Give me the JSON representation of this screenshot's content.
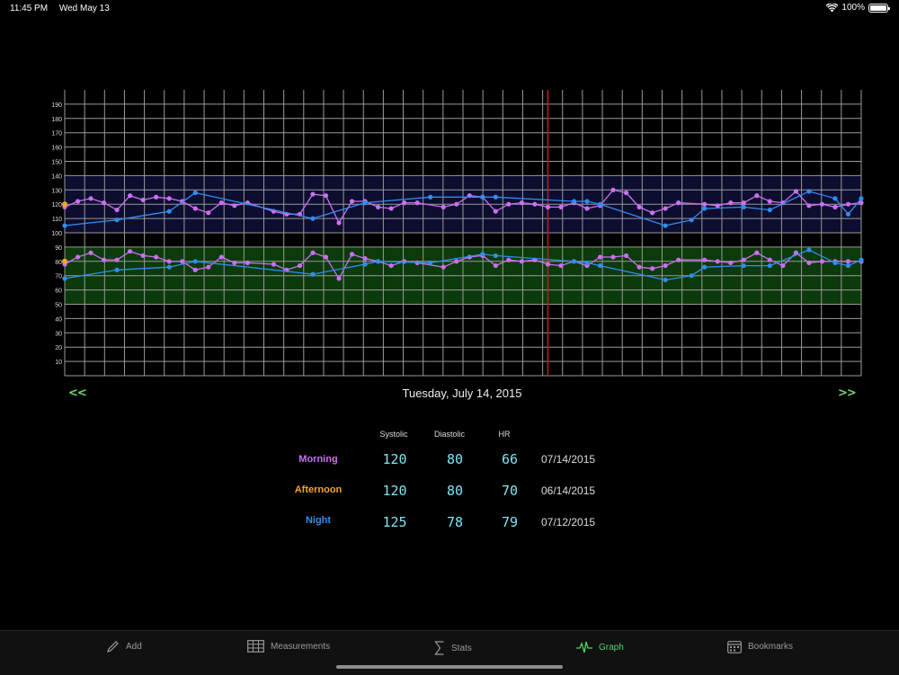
{
  "status": {
    "time": "11:45 PM",
    "date": "Wed May 13",
    "battery": "100%"
  },
  "chart_data": {
    "type": "line",
    "ylim": [
      0,
      200
    ],
    "yticks": [
      "10",
      "20",
      "30",
      "40",
      "50",
      "60",
      "70",
      "80",
      "90",
      "100",
      "110",
      "120",
      "130",
      "140",
      "150",
      "160",
      "170",
      "180",
      "190"
    ],
    "bands": [
      {
        "from": 100,
        "to": 140,
        "color": "#0d0d30"
      },
      {
        "from": 50,
        "to": 90,
        "color": "#0b3a0b"
      }
    ],
    "cursor_index": 18.5,
    "x_count": 41,
    "series": [
      {
        "line": "morning-systolic",
        "color": "#cc6ff0",
        "points": [
          [
            0,
            118
          ],
          [
            0.5,
            122
          ],
          [
            1,
            124
          ],
          [
            1.5,
            121
          ],
          [
            2,
            116
          ],
          [
            2.5,
            126
          ],
          [
            3,
            123
          ],
          [
            3.5,
            125
          ],
          [
            4,
            124
          ],
          [
            4.5,
            122
          ],
          [
            5,
            117
          ],
          [
            5.5,
            114
          ],
          [
            6,
            121
          ],
          [
            6.5,
            119
          ],
          [
            7,
            121
          ],
          [
            8,
            115
          ],
          [
            8.5,
            113
          ],
          [
            9,
            113
          ],
          [
            9.5,
            127
          ],
          [
            10,
            126
          ],
          [
            10.5,
            107
          ],
          [
            11,
            122
          ],
          [
            11.5,
            122
          ],
          [
            12,
            118
          ],
          [
            12.5,
            117
          ],
          [
            13,
            121
          ],
          [
            13.5,
            121
          ],
          [
            14.5,
            118
          ],
          [
            15,
            120
          ],
          [
            15.5,
            126
          ],
          [
            16,
            125
          ],
          [
            16.5,
            115
          ],
          [
            17,
            120
          ],
          [
            17.5,
            121
          ],
          [
            18,
            120
          ],
          [
            18.5,
            118
          ],
          [
            19,
            118
          ],
          [
            19.5,
            121
          ],
          [
            20,
            117
          ],
          [
            20.5,
            119
          ],
          [
            21,
            130
          ],
          [
            21.5,
            128
          ],
          [
            22,
            118
          ],
          [
            22.5,
            114
          ],
          [
            23,
            117
          ],
          [
            23.5,
            121
          ],
          [
            24.5,
            120
          ],
          [
            25,
            119
          ],
          [
            25.5,
            121
          ],
          [
            26,
            121
          ],
          [
            26.5,
            126
          ],
          [
            27,
            122
          ],
          [
            27.5,
            121
          ],
          [
            28,
            129
          ],
          [
            28.5,
            119
          ],
          [
            29,
            120
          ],
          [
            29.5,
            118
          ],
          [
            30,
            120
          ],
          [
            30.5,
            121
          ]
        ]
      },
      {
        "line": "morning-diastolic",
        "color": "#cc6ff0",
        "points": [
          [
            0,
            78
          ],
          [
            0.5,
            83
          ],
          [
            1,
            86
          ],
          [
            1.5,
            81
          ],
          [
            2,
            81
          ],
          [
            2.5,
            87
          ],
          [
            3,
            84
          ],
          [
            3.5,
            83
          ],
          [
            4,
            80
          ],
          [
            4.5,
            80
          ],
          [
            5,
            74
          ],
          [
            5.5,
            76
          ],
          [
            6,
            83
          ],
          [
            6.5,
            79
          ],
          [
            7,
            79
          ],
          [
            8,
            78
          ],
          [
            8.5,
            74
          ],
          [
            9,
            77
          ],
          [
            9.5,
            86
          ],
          [
            10,
            83
          ],
          [
            10.5,
            68
          ],
          [
            11,
            85
          ],
          [
            11.5,
            82
          ],
          [
            12,
            80
          ],
          [
            12.5,
            77
          ],
          [
            13,
            80
          ],
          [
            13.5,
            79
          ],
          [
            14.5,
            76
          ],
          [
            15,
            80
          ],
          [
            15.5,
            83
          ],
          [
            16,
            84
          ],
          [
            16.5,
            77
          ],
          [
            17,
            81
          ],
          [
            17.5,
            80
          ],
          [
            18,
            81
          ],
          [
            18.5,
            78
          ],
          [
            19,
            77
          ],
          [
            19.5,
            80
          ],
          [
            20,
            77
          ],
          [
            20.5,
            83
          ],
          [
            21,
            83
          ],
          [
            21.5,
            84
          ],
          [
            22,
            76
          ],
          [
            22.5,
            75
          ],
          [
            23,
            77
          ],
          [
            23.5,
            81
          ],
          [
            24.5,
            81
          ],
          [
            25,
            80
          ],
          [
            25.5,
            79
          ],
          [
            26,
            81
          ],
          [
            26.5,
            86
          ],
          [
            27,
            81
          ],
          [
            27.5,
            77
          ],
          [
            28,
            86
          ],
          [
            28.5,
            79
          ],
          [
            29,
            80
          ],
          [
            29.5,
            80
          ],
          [
            30,
            80
          ],
          [
            30.5,
            80
          ]
        ]
      },
      {
        "line": "night-systolic",
        "color": "#2f8ef0",
        "points": [
          [
            0,
            105
          ],
          [
            2,
            109
          ],
          [
            4,
            115
          ],
          [
            5,
            128
          ],
          [
            9.5,
            110
          ],
          [
            11.5,
            121
          ],
          [
            14,
            125
          ],
          [
            16,
            125
          ],
          [
            16.5,
            125
          ],
          [
            19.5,
            122
          ],
          [
            20,
            122
          ],
          [
            20.5,
            120
          ],
          [
            23,
            105
          ],
          [
            24,
            109
          ],
          [
            24.5,
            117
          ],
          [
            26,
            118
          ],
          [
            27,
            116
          ],
          [
            28.5,
            129
          ],
          [
            29.5,
            124
          ],
          [
            30,
            113
          ],
          [
            30.5,
            124
          ]
        ]
      },
      {
        "line": "night-diastolic",
        "color": "#2f8ef0",
        "points": [
          [
            0,
            68
          ],
          [
            2,
            74
          ],
          [
            4,
            76
          ],
          [
            5,
            80
          ],
          [
            9.5,
            71
          ],
          [
            11.5,
            78
          ],
          [
            12,
            80
          ],
          [
            14,
            79
          ],
          [
            16,
            85
          ],
          [
            16.5,
            84
          ],
          [
            19.5,
            80
          ],
          [
            20,
            79
          ],
          [
            20.5,
            77
          ],
          [
            23,
            67
          ],
          [
            24,
            70
          ],
          [
            24.5,
            76
          ],
          [
            26,
            77
          ],
          [
            27,
            77
          ],
          [
            28.5,
            88
          ],
          [
            29.5,
            79
          ],
          [
            30,
            77
          ],
          [
            30.5,
            81
          ]
        ]
      },
      {
        "line": "afternoon",
        "color": "#f5a623",
        "points": [
          [
            0,
            120
          ],
          [
            0,
            80
          ]
        ]
      }
    ]
  },
  "nav": {
    "prev": "<<",
    "next": ">>",
    "date": "Tuesday, July 14, 2015"
  },
  "readings": {
    "headers": {
      "systolic": "Systolic",
      "diastolic": "Diastolic",
      "hr": "HR"
    },
    "rows": [
      {
        "label": "Morning",
        "color": "#cc6ff0",
        "systolic": "120",
        "diastolic": "80",
        "hr": "66",
        "date": "07/14/2015"
      },
      {
        "label": "Afternoon",
        "color": "#f5a623",
        "systolic": "120",
        "diastolic": "80",
        "hr": "70",
        "date": "06/14/2015"
      },
      {
        "label": "Night",
        "color": "#2f8ef0",
        "systolic": "125",
        "diastolic": "78",
        "hr": "79",
        "date": "07/12/2015"
      }
    ]
  },
  "tabs": [
    {
      "label": "Add",
      "icon": "pencil-icon"
    },
    {
      "label": "Measurements",
      "icon": "table-icon"
    },
    {
      "label": "Stats",
      "icon": "sigma-icon"
    },
    {
      "label": "Graph",
      "icon": "pulse-icon",
      "active": true
    },
    {
      "label": "Bookmarks",
      "icon": "calendar-icon"
    }
  ]
}
